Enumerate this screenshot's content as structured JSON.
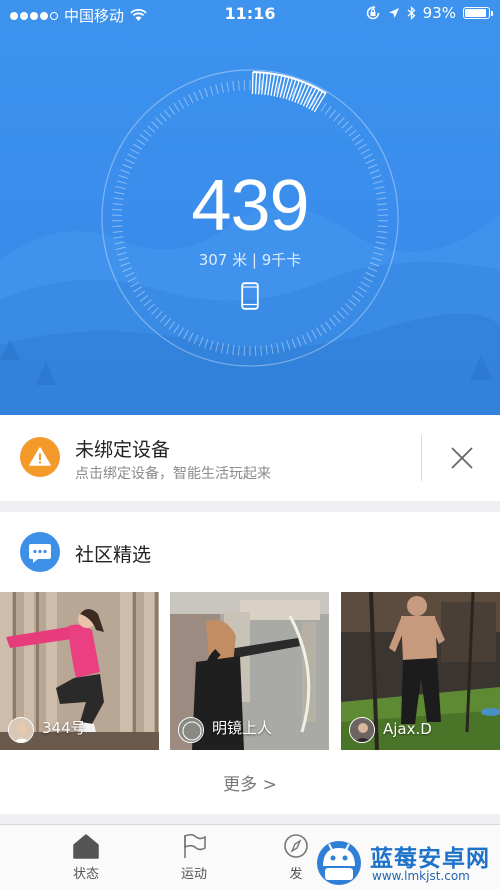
{
  "status_bar": {
    "carrier": "中国移动",
    "time": "11:16",
    "battery": "93%",
    "battery_level": 0.93
  },
  "summary": {
    "steps": "439",
    "distance_calories": "307 米 | 9千卡"
  },
  "device_card": {
    "title": "未绑定设备",
    "subtitle": "点击绑定设备，智能生活玩起来"
  },
  "community": {
    "title": "社区精选",
    "posts": [
      {
        "user": "344号"
      },
      {
        "user": "明镜上人"
      },
      {
        "user": "Ajax.D"
      }
    ],
    "more": "更多 >"
  },
  "tabbar": {
    "tabs": [
      {
        "label": "状态",
        "icon": "home-icon"
      },
      {
        "label": "运动",
        "icon": "flag-icon"
      },
      {
        "label": "发",
        "icon": "discover-icon"
      }
    ]
  },
  "watermark": {
    "title": "蓝莓安卓网",
    "url": "www.lmkjst.com"
  },
  "colors": {
    "hero_blue": "#3a8ceb",
    "warning_orange": "#f39a2b",
    "community_blue": "#3d8fe8"
  }
}
